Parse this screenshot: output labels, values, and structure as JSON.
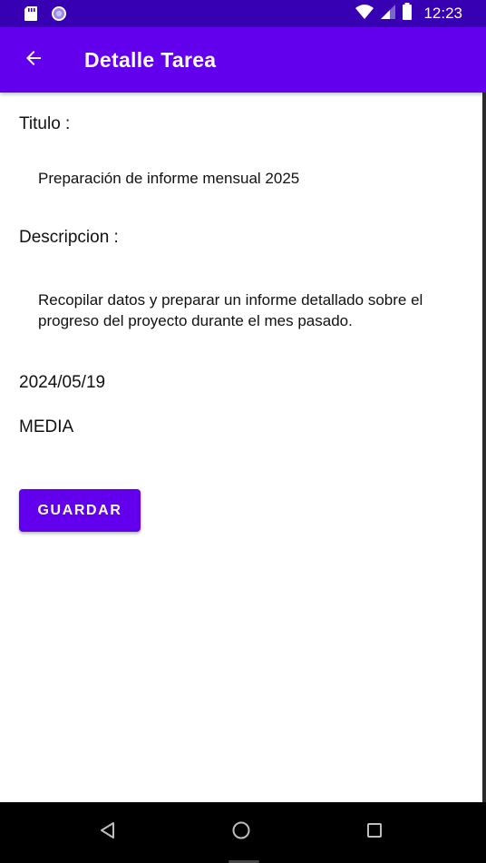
{
  "status_bar": {
    "time": "12:23",
    "icons": [
      "sd-card-icon",
      "sync-icon",
      "wifi-icon",
      "signal-icon",
      "battery-icon"
    ]
  },
  "app_bar": {
    "title": "Detalle Tarea",
    "back_icon": "arrow-back-icon"
  },
  "task": {
    "title_label": "Titulo :",
    "title_value": "Preparación de informe mensual 2025",
    "description_label": "Descripcion :",
    "description_value": "Recopilar datos y preparar un informe detallado sobre el progreso del proyecto durante el mes pasado.",
    "date": "2024/05/19",
    "priority": "MEDIA"
  },
  "actions": {
    "save_label": "GUARDAR"
  },
  "navigation": {
    "buttons": [
      "back-triangle-icon",
      "home-circle-icon",
      "recents-square-icon"
    ]
  },
  "colors": {
    "primary": "#6200ee",
    "primary_dark": "#3700b3"
  }
}
